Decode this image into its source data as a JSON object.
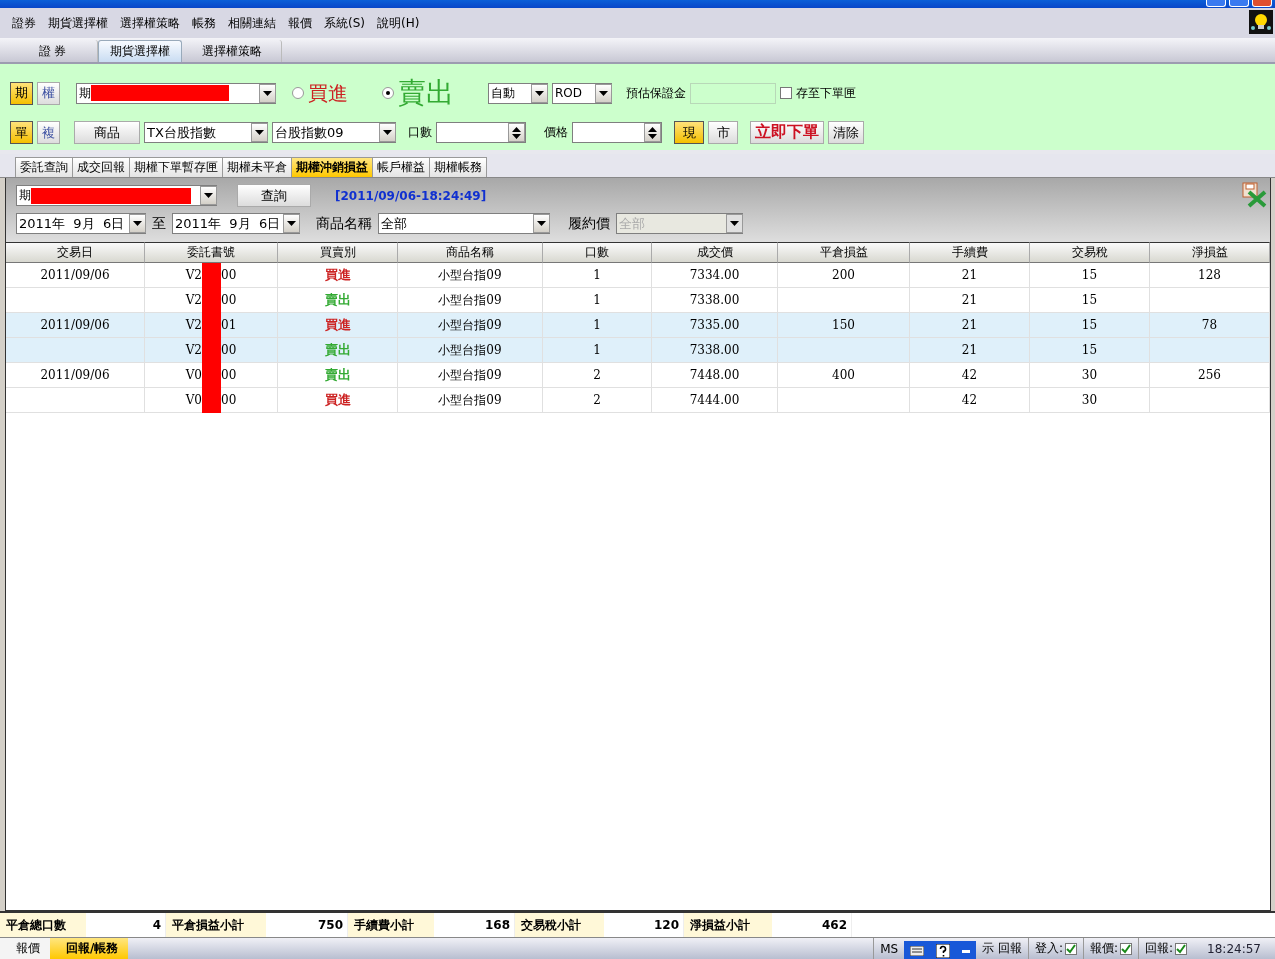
{
  "menu": [
    "證券",
    "期貨選擇權",
    "選擇權策略",
    "帳務",
    "相關連結",
    "報價",
    "系統(S)",
    "說明(H)"
  ],
  "main_tabs": [
    {
      "label": "證 券",
      "selected": false
    },
    {
      "label": "期貨選擇權",
      "selected": true
    },
    {
      "label": "選擇權策略",
      "selected": false
    }
  ],
  "order_panel": {
    "type_toggle": [
      {
        "label": "期",
        "selected": true
      },
      {
        "label": "權",
        "selected": false
      }
    ],
    "account": {
      "prefix": "期",
      "redacted": true
    },
    "sides": [
      {
        "label": "買進",
        "selected": false,
        "color": "#cc2222"
      },
      {
        "label": "賣出",
        "selected": true,
        "color": "#33aa33"
      }
    ],
    "mode": "自動",
    "tif": "ROD",
    "margin_label": "預估保證金",
    "save_label": "存至下單匣",
    "save_checked": false,
    "leg_toggle": [
      {
        "label": "單",
        "selected": true
      },
      {
        "label": "複",
        "selected": false
      }
    ],
    "product_button": "商品",
    "product": "TX台股指數",
    "contract": "台股指數09",
    "qty_label": "口數",
    "price_label": "價格",
    "price_type": [
      {
        "label": "現",
        "selected": true
      },
      {
        "label": "市",
        "selected": false
      }
    ],
    "submit": "立即下單",
    "clear": "清除"
  },
  "sub_tabs": [
    {
      "label": "委託查詢",
      "selected": false
    },
    {
      "label": "成交回報",
      "selected": false
    },
    {
      "label": "期權下單暫存匣",
      "selected": false
    },
    {
      "label": "期權未平倉",
      "selected": false
    },
    {
      "label": "期權沖銷損益",
      "selected": true
    },
    {
      "label": "帳戶權益",
      "selected": false
    },
    {
      "label": "期權帳務",
      "selected": false
    }
  ],
  "query": {
    "account": {
      "prefix": "期",
      "redacted": true
    },
    "query_button": "查詢",
    "timestamp": "[2011/09/06-18:24:49]",
    "date_from": "2011年  9月  6日",
    "to_label": "至",
    "date_to": "2011年  9月  6日",
    "product_label": "商品名稱",
    "product": "全部",
    "strike_label": "履約價",
    "strike": "全部",
    "strike_disabled": true
  },
  "table": {
    "columns": [
      "交易日",
      "委託書號",
      "買賣別",
      "商品名稱",
      "口數",
      "成交價",
      "平倉損益",
      "手續費",
      "交易稅",
      "淨損益"
    ],
    "rows": [
      {
        "shaded": false,
        "date": "2011/09/06",
        "order_no": {
          "start": "V2",
          "end": "00",
          "redacted": true
        },
        "side": {
          "label": "買進",
          "color": "#cc2222"
        },
        "product": "小型台指09",
        "qty": "1",
        "price": "7334.00",
        "pnl": "200",
        "fee": "21",
        "tax": "15",
        "net": "128"
      },
      {
        "shaded": false,
        "date": "",
        "order_no": {
          "start": "V2",
          "end": "00",
          "redacted": true
        },
        "side": {
          "label": "賣出",
          "color": "#33aa33"
        },
        "product": "小型台指09",
        "qty": "1",
        "price": "7338.00",
        "pnl": "",
        "fee": "21",
        "tax": "15",
        "net": ""
      },
      {
        "shaded": true,
        "date": "2011/09/06",
        "order_no": {
          "start": "V2",
          "end": "01",
          "redacted": true
        },
        "side": {
          "label": "買進",
          "color": "#cc2222"
        },
        "product": "小型台指09",
        "qty": "1",
        "price": "7335.00",
        "pnl": "150",
        "fee": "21",
        "tax": "15",
        "net": "78"
      },
      {
        "shaded": true,
        "date": "",
        "order_no": {
          "start": "V2",
          "end": "00",
          "redacted": true
        },
        "side": {
          "label": "賣出",
          "color": "#33aa33"
        },
        "product": "小型台指09",
        "qty": "1",
        "price": "7338.00",
        "pnl": "",
        "fee": "21",
        "tax": "15",
        "net": ""
      },
      {
        "shaded": false,
        "date": "2011/09/06",
        "order_no": {
          "start": "V0",
          "end": "00",
          "redacted": true
        },
        "side": {
          "label": "賣出",
          "color": "#33aa33"
        },
        "product": "小型台指09",
        "qty": "2",
        "price": "7448.00",
        "pnl": "400",
        "fee": "42",
        "tax": "30",
        "net": "256"
      },
      {
        "shaded": false,
        "date": "",
        "order_no": {
          "start": "V0",
          "end": "00",
          "redacted": true
        },
        "side": {
          "label": "買進",
          "color": "#cc2222"
        },
        "product": "小型台指09",
        "qty": "2",
        "price": "7444.00",
        "pnl": "",
        "fee": "42",
        "tax": "30",
        "net": ""
      }
    ]
  },
  "summary": [
    {
      "label": "平倉總口數",
      "value": "4"
    },
    {
      "label": "平倉損益小計",
      "value": "750"
    },
    {
      "label": "手續費小計",
      "value": "168"
    },
    {
      "label": "交易稅小計",
      "value": "120"
    },
    {
      "label": "淨損益小計",
      "value": "462"
    }
  ],
  "bottom_tabs": [
    {
      "label": "報價",
      "selected": false
    },
    {
      "label": "回報/帳務",
      "selected": true
    }
  ],
  "status_bar": {
    "left_text": "MS",
    "right_text": "示 回報",
    "checks": [
      {
        "label": "登入:",
        "checked": true
      },
      {
        "label": "報價:",
        "checked": true
      },
      {
        "label": "回報:",
        "checked": true
      }
    ],
    "time": "18:24:57"
  }
}
